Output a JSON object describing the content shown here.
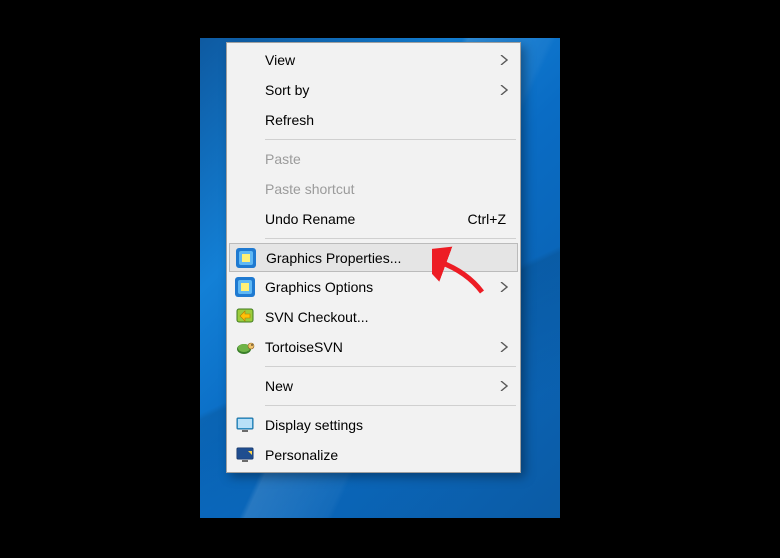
{
  "menu": {
    "view": {
      "label": "View",
      "has_submenu": true,
      "enabled": true
    },
    "sort_by": {
      "label": "Sort by",
      "has_submenu": true,
      "enabled": true
    },
    "refresh": {
      "label": "Refresh",
      "has_submenu": false,
      "enabled": true
    },
    "paste": {
      "label": "Paste",
      "has_submenu": false,
      "enabled": false
    },
    "paste_shortcut": {
      "label": "Paste shortcut",
      "has_submenu": false,
      "enabled": false
    },
    "undo_rename": {
      "label": "Undo Rename",
      "has_submenu": false,
      "enabled": true,
      "shortcut": "Ctrl+Z"
    },
    "graphics_properties": {
      "label": "Graphics Properties...",
      "has_submenu": false,
      "enabled": true,
      "icon": "intel-graphics",
      "highlighted": true
    },
    "graphics_options": {
      "label": "Graphics Options",
      "has_submenu": true,
      "enabled": true,
      "icon": "intel-graphics"
    },
    "svn_checkout": {
      "label": "SVN Checkout...",
      "has_submenu": false,
      "enabled": true,
      "icon": "svn-checkout"
    },
    "tortoise_svn": {
      "label": "TortoiseSVN",
      "has_submenu": true,
      "enabled": true,
      "icon": "tortoise"
    },
    "new": {
      "label": "New",
      "has_submenu": true,
      "enabled": true
    },
    "display_settings": {
      "label": "Display settings",
      "has_submenu": false,
      "enabled": true,
      "icon": "display"
    },
    "personalize": {
      "label": "Personalize",
      "has_submenu": false,
      "enabled": true,
      "icon": "personalize"
    }
  },
  "annotation": {
    "color": "#ed1c24",
    "target": "graphics_properties"
  }
}
